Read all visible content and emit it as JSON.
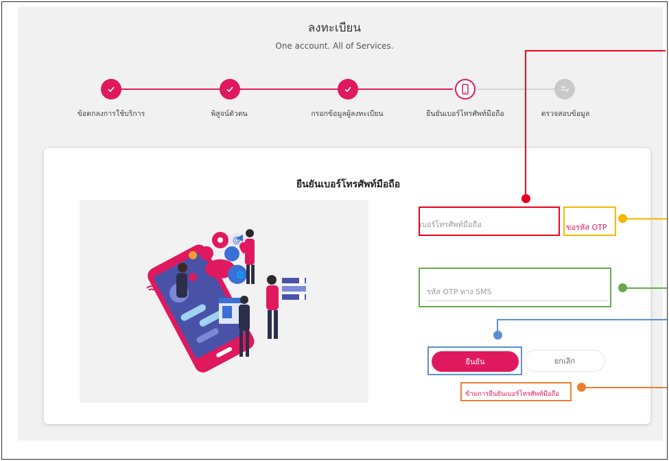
{
  "header": {
    "title": "ลงทะเบียน",
    "subtitle": "One account. All of Services."
  },
  "stepper": {
    "steps": [
      {
        "label": "ข้อตกลงการใช้บริการ",
        "state": "done",
        "icon": "check-icon"
      },
      {
        "label": "พิสูจน์ตัวตน",
        "state": "done",
        "icon": "check-icon"
      },
      {
        "label": "กรอกข้อมูลผู้ลงทะเบียน",
        "state": "done",
        "icon": "check-icon"
      },
      {
        "label": "ยืนยันเบอร์โทรศัพท์มือถือ",
        "state": "current",
        "icon": "phone-icon"
      },
      {
        "label": "ตรวจสอบข้อมูล",
        "state": "pending",
        "icon": "checklist-icon"
      }
    ]
  },
  "card": {
    "title": "ยืนยันเบอร์โทรศัพท์มือถือ",
    "phone_placeholder": "เบอร์โทรศัพท์มือถือ",
    "request_otp_label": "ขอรหัส OTP",
    "otp_placeholder": "รหัส OTP ทาง SMS",
    "confirm_label": "ยืนยัน",
    "cancel_label": "ยกเลิก",
    "skip_label": "ข้ามการยืนยันเบอร์โทรศัพท์มือถือ"
  },
  "colors": {
    "accent": "#e0195e",
    "pending": "#c9c9c9",
    "annotation_red": "#e8001c",
    "annotation_yellow": "#f5b800",
    "annotation_green": "#6aa84f",
    "annotation_blue": "#5b8fd0",
    "annotation_orange": "#ed7d31"
  }
}
